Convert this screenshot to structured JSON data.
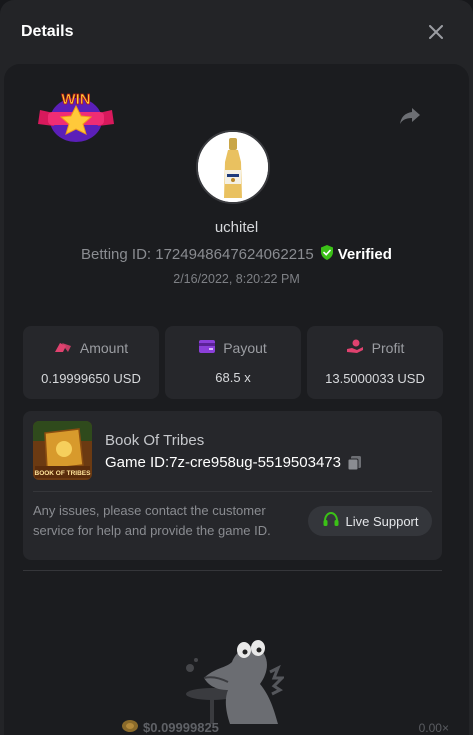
{
  "header": {
    "title": "Details",
    "close_icon": "close-icon"
  },
  "badge": {
    "text": "WIN",
    "icon": "win-badge-icon"
  },
  "share_icon": "share-icon",
  "user": {
    "username": "uchitel",
    "betting_id_label": "Betting ID: 1724948647624062215",
    "verified_label": "Verified",
    "timestamp": "2/16/2022, 8:20:22 PM"
  },
  "stats": [
    {
      "label": "Amount",
      "value": "0.19999650 USD",
      "icon": "amount-icon",
      "color": "#e0426f"
    },
    {
      "label": "Payout",
      "value": "68.5 x",
      "icon": "payout-card-icon",
      "color": "#8b3fd9"
    },
    {
      "label": "Profit",
      "value": "13.5000033 USD",
      "icon": "profit-icon",
      "color": "#e0426f"
    }
  ],
  "game": {
    "name": "Book Of Tribes",
    "game_id": "Game ID:7z-cre958ug-5519503473",
    "thumb_text": "BOOK OF TRIBES",
    "issues_text": "Any issues, please contact the customer service for help and provide the game ID.",
    "live_support_label": "Live Support"
  },
  "footer": {
    "amount": "$0.09999825",
    "multiplier": "0.00×"
  },
  "colors": {
    "verified": "#3bc117",
    "support_icon": "#3bc117",
    "background": "#1b1c1f"
  }
}
